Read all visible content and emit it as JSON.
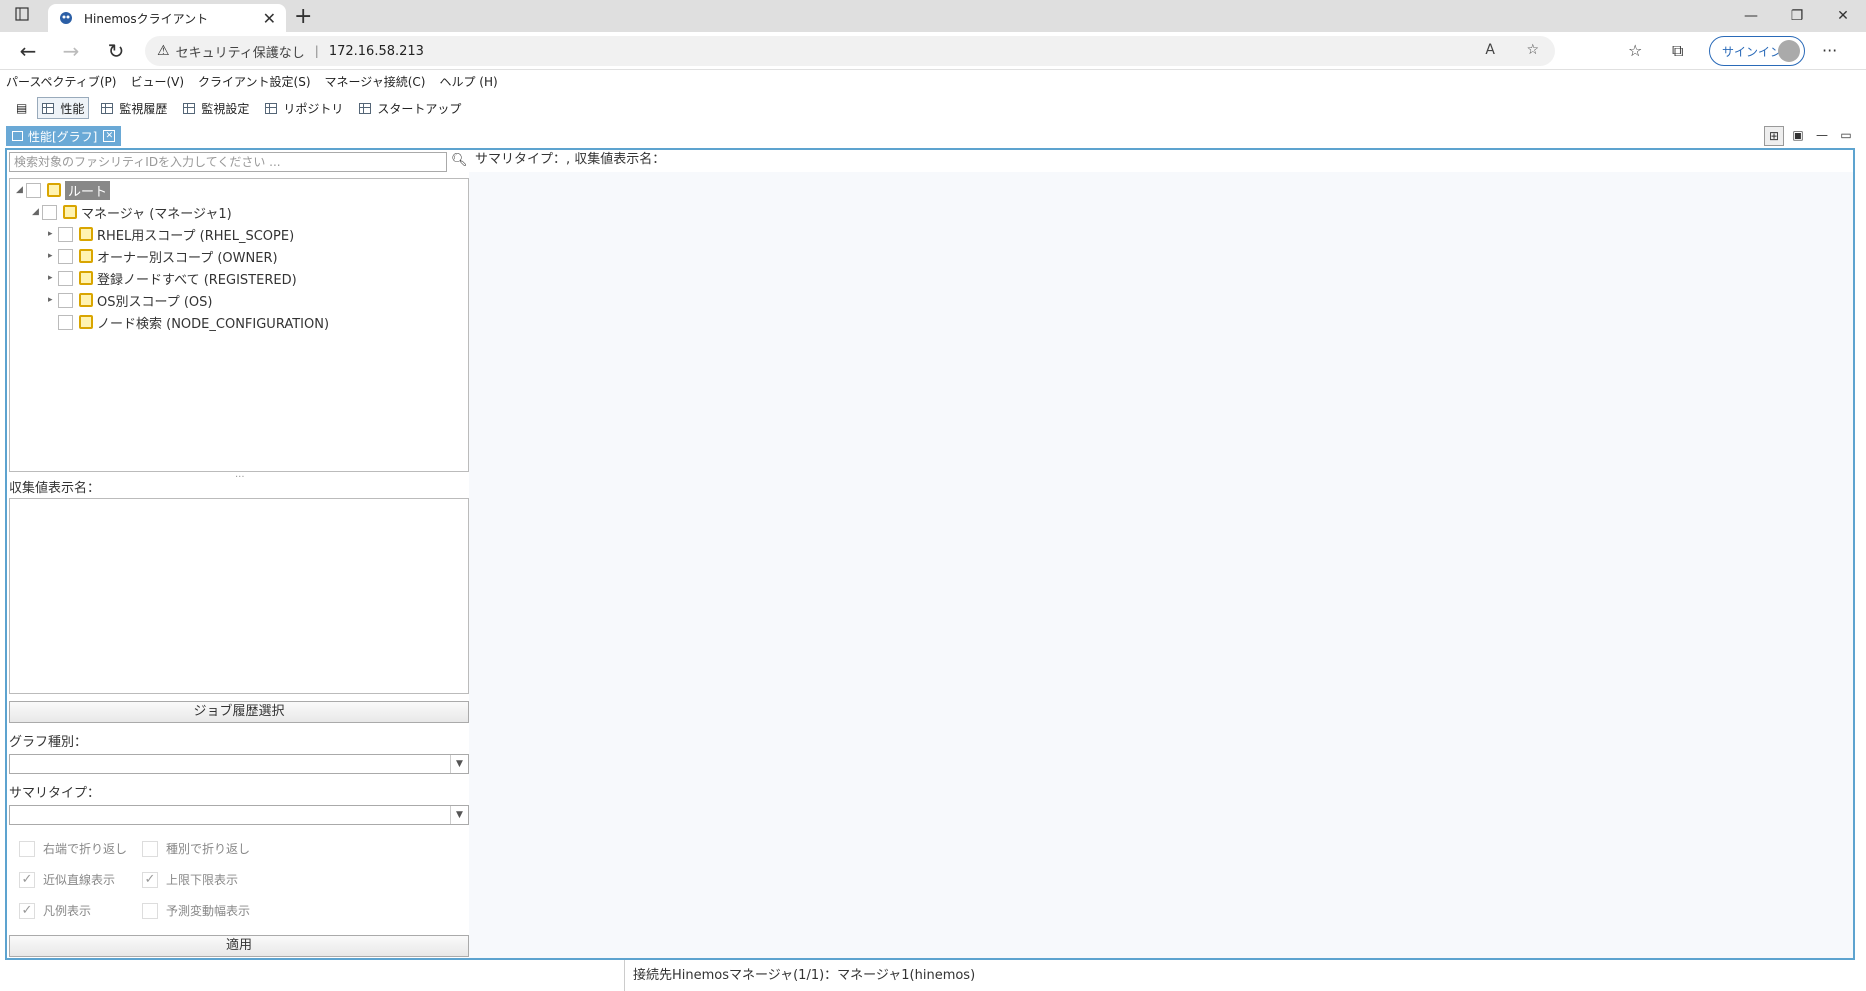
{
  "browser": {
    "tab_title": "Hinemosクライアント",
    "security_label": "セキュリティ保護なし",
    "url": "172.16.58.213",
    "signin_label": "サインイン"
  },
  "menu": [
    "パースペクティブ(P)",
    "ビュー(V)",
    "クライアント設定(S)",
    "マネージャ接続(C)",
    "ヘルプ (H)"
  ],
  "perspectives": [
    {
      "label": "性能",
      "active": true
    },
    {
      "label": "監視履歴",
      "active": false
    },
    {
      "label": "監視設定",
      "active": false
    },
    {
      "label": "リポジトリ",
      "active": false
    },
    {
      "label": "スタートアップ",
      "active": false
    }
  ],
  "view": {
    "tab_label": "性能[グラフ]",
    "search_placeholder": "検索対象のファシリティIDを入力してください ...",
    "right_header": "サマリタイプ：,  収集値表示名："
  },
  "tree": [
    {
      "label": "ルート",
      "level": 0,
      "expanded": true,
      "selected": true
    },
    {
      "label": "マネージャ (マネージャ1)",
      "level": 1,
      "expanded": true
    },
    {
      "label": "RHEL用スコープ (RHEL_SCOPE)",
      "level": 2,
      "expandable": true
    },
    {
      "label": "オーナー別スコープ (OWNER)",
      "level": 2,
      "expandable": true
    },
    {
      "label": "登録ノードすべて (REGISTERED)",
      "level": 2,
      "expandable": true
    },
    {
      "label": "OS別スコープ (OS)",
      "level": 2,
      "expandable": true
    },
    {
      "label": "ノード検索 (NODE_CONFIGURATION)",
      "level": 2,
      "expandable": false
    }
  ],
  "form": {
    "collect_label": "収集値表示名：",
    "job_history_button": "ジョブ履歴選択",
    "graph_type_label": "グラフ種別：",
    "graph_type_value": "",
    "summary_type_label": "サマリタイプ：",
    "summary_type_value": "",
    "options": [
      {
        "label": "右端で折り返し",
        "checked": false
      },
      {
        "label": "種別で折り返し",
        "checked": false
      },
      {
        "label": "近似直線表示",
        "checked": true
      },
      {
        "label": "上限下限表示",
        "checked": true
      },
      {
        "label": "凡例表示",
        "checked": true
      },
      {
        "label": "予測変動幅表示",
        "checked": false
      }
    ],
    "apply_button": "適用"
  },
  "status": {
    "text": "接続先Hinemosマネージャ(1/1)：マネージャ1(hinemos)"
  }
}
